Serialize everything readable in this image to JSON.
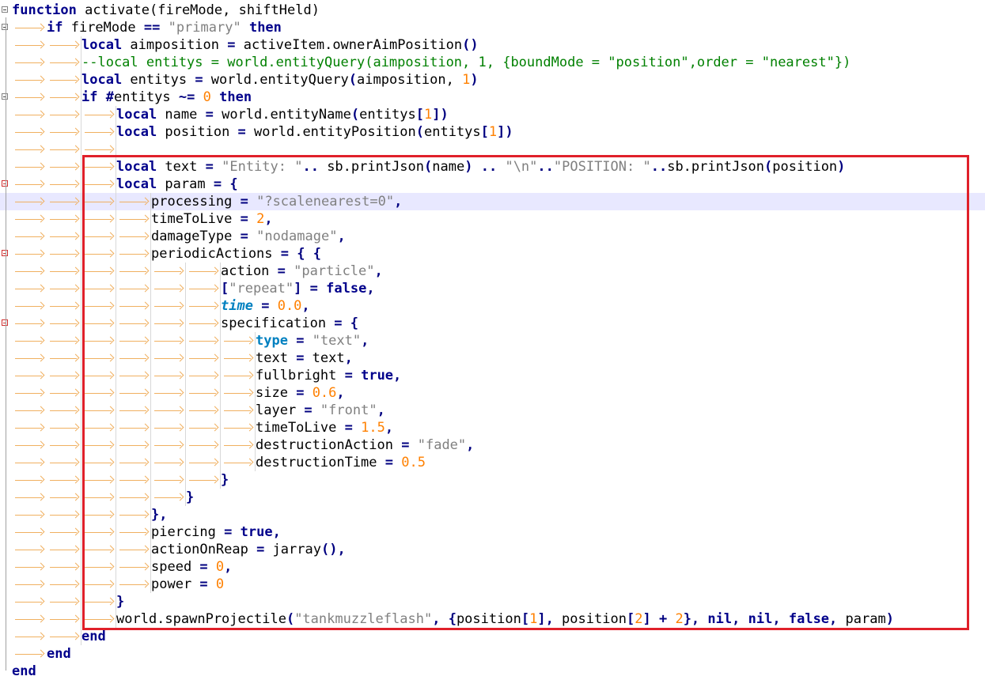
{
  "editor": {
    "language": "lua",
    "current_line_index": 11,
    "lines": [
      {
        "indent": 0,
        "fold": "open",
        "tokens": [
          [
            "k",
            "function"
          ],
          [
            "f",
            " activate(fireMode, shiftHeld)"
          ]
        ]
      },
      {
        "indent": 1,
        "fold": "open",
        "tokens": [
          [
            "k",
            "if"
          ],
          [
            "f",
            " fireMode "
          ],
          [
            "o",
            "=="
          ],
          [
            "f",
            " "
          ],
          [
            "s",
            "\"primary\""
          ],
          [
            "f",
            " "
          ],
          [
            "k",
            "then"
          ]
        ]
      },
      {
        "indent": 2,
        "tokens": [
          [
            "k",
            "local"
          ],
          [
            "f",
            " aimposition "
          ],
          [
            "o",
            "="
          ],
          [
            "f",
            " activeItem.ownerAimPosition"
          ],
          [
            "o",
            "()"
          ]
        ]
      },
      {
        "indent": 2,
        "tokens": [
          [
            "c",
            "--local entitys = world.entityQuery(aimposition, 1, {boundMode = \"position\",order = \"nearest\"})"
          ]
        ]
      },
      {
        "indent": 2,
        "tokens": [
          [
            "k",
            "local"
          ],
          [
            "f",
            " entitys "
          ],
          [
            "o",
            "="
          ],
          [
            "f",
            " world.entityQuery"
          ],
          [
            "o",
            "("
          ],
          [
            "f",
            "aimposition, "
          ],
          [
            "n",
            "1"
          ],
          [
            "o",
            ")"
          ]
        ]
      },
      {
        "indent": 2,
        "fold": "open",
        "tokens": [
          [
            "k",
            "if"
          ],
          [
            "f",
            " "
          ],
          [
            "o",
            "#"
          ],
          [
            "f",
            "entitys "
          ],
          [
            "o",
            "~="
          ],
          [
            "f",
            " "
          ],
          [
            "n",
            "0"
          ],
          [
            "f",
            " "
          ],
          [
            "k",
            "then"
          ]
        ]
      },
      {
        "indent": 3,
        "tokens": [
          [
            "k",
            "local"
          ],
          [
            "f",
            " name "
          ],
          [
            "o",
            "="
          ],
          [
            "f",
            " world.entityName"
          ],
          [
            "o",
            "("
          ],
          [
            "f",
            "entitys"
          ],
          [
            "o",
            "["
          ],
          [
            "n",
            "1"
          ],
          [
            "o",
            "])"
          ]
        ]
      },
      {
        "indent": 3,
        "tokens": [
          [
            "k",
            "local"
          ],
          [
            "f",
            " position "
          ],
          [
            "o",
            "="
          ],
          [
            "f",
            " world.entityPosition"
          ],
          [
            "o",
            "("
          ],
          [
            "f",
            "entitys"
          ],
          [
            "o",
            "["
          ],
          [
            "n",
            "1"
          ],
          [
            "o",
            "])"
          ]
        ]
      },
      {
        "indent": 3,
        "tokens": []
      },
      {
        "indent": 3,
        "tokens": [
          [
            "k",
            "local"
          ],
          [
            "f",
            " text "
          ],
          [
            "o",
            "="
          ],
          [
            "f",
            " "
          ],
          [
            "s",
            "\"Entity: \""
          ],
          [
            "o",
            ".."
          ],
          [
            "f",
            " sb.printJson"
          ],
          [
            "o",
            "("
          ],
          [
            "f",
            "name"
          ],
          [
            "o",
            ")"
          ],
          [
            "f",
            " "
          ],
          [
            "o",
            ".."
          ],
          [
            "f",
            " "
          ],
          [
            "s",
            "\"\\n\""
          ],
          [
            "o",
            ".."
          ],
          [
            "s",
            "\"POSITION: \""
          ],
          [
            "o",
            ".."
          ],
          [
            "f",
            "sb.printJson"
          ],
          [
            "o",
            "("
          ],
          [
            "f",
            "position"
          ],
          [
            "o",
            ")"
          ]
        ]
      },
      {
        "indent": 3,
        "fold": "open-red",
        "tokens": [
          [
            "k",
            "local"
          ],
          [
            "f",
            " param "
          ],
          [
            "o",
            "="
          ],
          [
            "f",
            " "
          ],
          [
            "o",
            "{"
          ]
        ]
      },
      {
        "indent": 4,
        "tokens": [
          [
            "f",
            "processing "
          ],
          [
            "o",
            "="
          ],
          [
            "f",
            " "
          ],
          [
            "s",
            "\"?scalenearest=0\""
          ],
          [
            "o",
            ","
          ]
        ]
      },
      {
        "indent": 4,
        "tokens": [
          [
            "f",
            "timeToLive "
          ],
          [
            "o",
            "="
          ],
          [
            "f",
            " "
          ],
          [
            "n",
            "2"
          ],
          [
            "o",
            ","
          ]
        ]
      },
      {
        "indent": 4,
        "tokens": [
          [
            "f",
            "damageType "
          ],
          [
            "o",
            "="
          ],
          [
            "f",
            " "
          ],
          [
            "s",
            "\"nodamage\""
          ],
          [
            "o",
            ","
          ]
        ]
      },
      {
        "indent": 4,
        "fold": "open-red",
        "tokens": [
          [
            "f",
            "periodicActions "
          ],
          [
            "o",
            "="
          ],
          [
            "f",
            " "
          ],
          [
            "o",
            "{"
          ],
          [
            "f",
            " "
          ],
          [
            "o",
            "{"
          ]
        ]
      },
      {
        "indent": 6,
        "tokens": [
          [
            "f",
            "action "
          ],
          [
            "o",
            "="
          ],
          [
            "f",
            " "
          ],
          [
            "s",
            "\"particle\""
          ],
          [
            "o",
            ","
          ]
        ]
      },
      {
        "indent": 6,
        "tokens": [
          [
            "o",
            "["
          ],
          [
            "s",
            "\"repeat\""
          ],
          [
            "o",
            "]"
          ],
          [
            "f",
            " "
          ],
          [
            "o",
            "="
          ],
          [
            "f",
            " "
          ],
          [
            "k",
            "false"
          ],
          [
            "o",
            ","
          ]
        ]
      },
      {
        "indent": 6,
        "tokens": [
          [
            "kb",
            "time"
          ],
          [
            "f",
            " "
          ],
          [
            "o",
            "="
          ],
          [
            "f",
            " "
          ],
          [
            "n",
            "0.0"
          ],
          [
            "o",
            ","
          ]
        ]
      },
      {
        "indent": 6,
        "fold": "open-red",
        "tokens": [
          [
            "f",
            "specification "
          ],
          [
            "o",
            "="
          ],
          [
            "f",
            " "
          ],
          [
            "o",
            "{"
          ]
        ]
      },
      {
        "indent": 7,
        "tokens": [
          [
            "kt",
            "type"
          ],
          [
            "f",
            " "
          ],
          [
            "o",
            "="
          ],
          [
            "f",
            " "
          ],
          [
            "s",
            "\"text\""
          ],
          [
            "o",
            ","
          ]
        ]
      },
      {
        "indent": 7,
        "tokens": [
          [
            "f",
            "text "
          ],
          [
            "o",
            "="
          ],
          [
            "f",
            " text"
          ],
          [
            "o",
            ","
          ]
        ]
      },
      {
        "indent": 7,
        "tokens": [
          [
            "f",
            "fullbright "
          ],
          [
            "o",
            "="
          ],
          [
            "f",
            " "
          ],
          [
            "k",
            "true"
          ],
          [
            "o",
            ","
          ]
        ]
      },
      {
        "indent": 7,
        "tokens": [
          [
            "f",
            "size "
          ],
          [
            "o",
            "="
          ],
          [
            "f",
            " "
          ],
          [
            "n",
            "0.6"
          ],
          [
            "o",
            ","
          ]
        ]
      },
      {
        "indent": 7,
        "tokens": [
          [
            "f",
            "layer "
          ],
          [
            "o",
            "="
          ],
          [
            "f",
            " "
          ],
          [
            "s",
            "\"front\""
          ],
          [
            "o",
            ","
          ]
        ]
      },
      {
        "indent": 7,
        "tokens": [
          [
            "f",
            "timeToLive "
          ],
          [
            "o",
            "="
          ],
          [
            "f",
            " "
          ],
          [
            "n",
            "1.5"
          ],
          [
            "o",
            ","
          ]
        ]
      },
      {
        "indent": 7,
        "tokens": [
          [
            "f",
            "destructionAction "
          ],
          [
            "o",
            "="
          ],
          [
            "f",
            " "
          ],
          [
            "s",
            "\"fade\""
          ],
          [
            "o",
            ","
          ]
        ]
      },
      {
        "indent": 7,
        "tokens": [
          [
            "f",
            "destructionTime "
          ],
          [
            "o",
            "="
          ],
          [
            "f",
            " "
          ],
          [
            "n",
            "0.5"
          ]
        ]
      },
      {
        "indent": 6,
        "tokens": [
          [
            "o",
            "}"
          ]
        ]
      },
      {
        "indent": 5,
        "tokens": [
          [
            "o",
            "}"
          ]
        ]
      },
      {
        "indent": 4,
        "tokens": [
          [
            "o",
            "},"
          ]
        ]
      },
      {
        "indent": 4,
        "tokens": [
          [
            "f",
            "piercing "
          ],
          [
            "o",
            "="
          ],
          [
            "f",
            " "
          ],
          [
            "k",
            "true"
          ],
          [
            "o",
            ","
          ]
        ]
      },
      {
        "indent": 4,
        "tokens": [
          [
            "f",
            "actionOnReap "
          ],
          [
            "o",
            "="
          ],
          [
            "f",
            " jarray"
          ],
          [
            "o",
            "(),"
          ]
        ]
      },
      {
        "indent": 4,
        "tokens": [
          [
            "f",
            "speed "
          ],
          [
            "o",
            "="
          ],
          [
            "f",
            " "
          ],
          [
            "n",
            "0"
          ],
          [
            "o",
            ","
          ]
        ]
      },
      {
        "indent": 4,
        "tokens": [
          [
            "f",
            "power "
          ],
          [
            "o",
            "="
          ],
          [
            "f",
            " "
          ],
          [
            "n",
            "0"
          ]
        ]
      },
      {
        "indent": 3,
        "tokens": [
          [
            "o",
            "}"
          ]
        ]
      },
      {
        "indent": 3,
        "tokens": [
          [
            "f",
            "world.spawnProjectile"
          ],
          [
            "o",
            "("
          ],
          [
            "s",
            "\"tankmuzzleflash\""
          ],
          [
            "o",
            ","
          ],
          [
            "f",
            " "
          ],
          [
            "o",
            "{"
          ],
          [
            "f",
            "position"
          ],
          [
            "o",
            "["
          ],
          [
            "n",
            "1"
          ],
          [
            "o",
            "],"
          ],
          [
            "f",
            " position"
          ],
          [
            "o",
            "["
          ],
          [
            "n",
            "2"
          ],
          [
            "o",
            "]"
          ],
          [
            "f",
            " "
          ],
          [
            "o",
            "+"
          ],
          [
            "f",
            " "
          ],
          [
            "n",
            "2"
          ],
          [
            "o",
            "},"
          ],
          [
            "f",
            " "
          ],
          [
            "k",
            "nil"
          ],
          [
            "o",
            ","
          ],
          [
            "f",
            " "
          ],
          [
            "k",
            "nil"
          ],
          [
            "o",
            ","
          ],
          [
            "f",
            " "
          ],
          [
            "k",
            "false"
          ],
          [
            "o",
            ","
          ],
          [
            "f",
            " param"
          ],
          [
            "o",
            ")"
          ]
        ]
      },
      {
        "indent": 2,
        "tokens": [
          [
            "k",
            "end"
          ]
        ]
      },
      {
        "indent": 1,
        "tokens": [
          [
            "k",
            "end"
          ]
        ]
      },
      {
        "indent": 0,
        "tokens": [
          [
            "k",
            "end"
          ]
        ]
      }
    ]
  },
  "annotation": {
    "box_color": "#e0202a"
  },
  "colors": {
    "keyword": "#00008b",
    "string": "#808080",
    "number": "#ff8000",
    "comment": "#008000",
    "indent_arrow": "#f0b060",
    "fold_red": "#d03030",
    "current_line_bg": "#e8e8ff"
  }
}
